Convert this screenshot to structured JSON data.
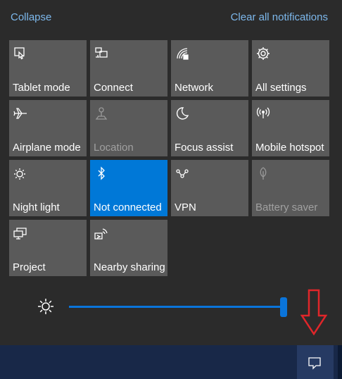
{
  "header": {
    "collapse_label": "Collapse",
    "clear_label": "Clear all notifications"
  },
  "tiles": [
    {
      "label": "Tablet mode",
      "icon": "tablet-mode-icon",
      "state": "off"
    },
    {
      "label": "Connect",
      "icon": "connect-icon",
      "state": "off"
    },
    {
      "label": "Network",
      "icon": "network-icon",
      "state": "off"
    },
    {
      "label": "All settings",
      "icon": "gear-icon",
      "state": "off"
    },
    {
      "label": "Airplane mode",
      "icon": "airplane-icon",
      "state": "off"
    },
    {
      "label": "Location",
      "icon": "location-icon",
      "state": "disabled"
    },
    {
      "label": "Focus assist",
      "icon": "moon-icon",
      "state": "off"
    },
    {
      "label": "Mobile hotspot",
      "icon": "hotspot-icon",
      "state": "off"
    },
    {
      "label": "Night light",
      "icon": "night-light-icon",
      "state": "off"
    },
    {
      "label": "Not connected",
      "icon": "bluetooth-icon",
      "state": "active"
    },
    {
      "label": "VPN",
      "icon": "vpn-icon",
      "state": "off"
    },
    {
      "label": "Battery saver",
      "icon": "battery-saver-icon",
      "state": "disabled"
    },
    {
      "label": "Project",
      "icon": "project-icon",
      "state": "off"
    },
    {
      "label": "Nearby sharing",
      "icon": "nearby-sharing-icon",
      "state": "off"
    }
  ],
  "brightness": {
    "level_percent": 100,
    "icon": "brightness-icon"
  },
  "annotation": {
    "icon": "red-down-arrow-icon",
    "color": "#e0262a"
  },
  "taskbar": {
    "action_center_icon": "action-center-icon"
  },
  "colors": {
    "accent": "#0078d7",
    "tile": "#5a5a5a",
    "panel": "#2b2b2b",
    "link": "#7db8ec",
    "taskbar": "#182848"
  }
}
